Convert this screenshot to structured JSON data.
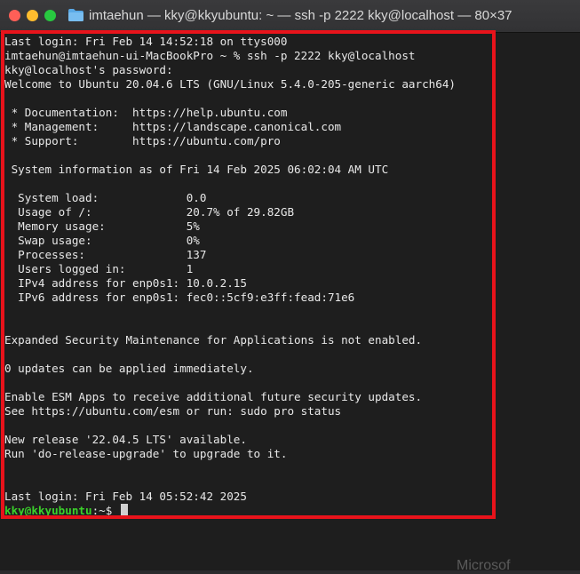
{
  "window": {
    "title": "imtaehun — kky@kkyubuntu: ~ — ssh -p 2222 kky@localhost — 80×37"
  },
  "terminal": {
    "lines": [
      "Last login: Fri Feb 14 14:52:18 on ttys000",
      "imtaehun@imtaehun-ui-MacBookPro ~ % ssh -p 2222 kky@localhost",
      "kky@localhost's password:",
      "Welcome to Ubuntu 20.04.6 LTS (GNU/Linux 5.4.0-205-generic aarch64)",
      "",
      " * Documentation:  https://help.ubuntu.com",
      " * Management:     https://landscape.canonical.com",
      " * Support:        https://ubuntu.com/pro",
      "",
      " System information as of Fri 14 Feb 2025 06:02:04 AM UTC",
      "",
      "  System load:             0.0",
      "  Usage of /:              20.7% of 29.82GB",
      "  Memory usage:            5%",
      "  Swap usage:              0%",
      "  Processes:               137",
      "  Users logged in:         1",
      "  IPv4 address for enp0s1: 10.0.2.15",
      "  IPv6 address for enp0s1: fec0::5cf9:e3ff:fead:71e6",
      "",
      "",
      "Expanded Security Maintenance for Applications is not enabled.",
      "",
      "0 updates can be applied immediately.",
      "",
      "Enable ESM Apps to receive additional future security updates.",
      "See https://ubuntu.com/esm or run: sudo pro status",
      "",
      "New release '22.04.5 LTS' available.",
      "Run 'do-release-upgrade' to upgrade to it.",
      "",
      "",
      "Last login: Fri Feb 14 05:52:42 2025"
    ],
    "prompt": {
      "user_host": "kky@kkyubuntu",
      "path": ":~",
      "symbol": "$ "
    }
  },
  "background": {
    "peek_text": "Microsof"
  },
  "colors": {
    "highlight": "#e8131b",
    "prompt": "#3bd12b"
  }
}
